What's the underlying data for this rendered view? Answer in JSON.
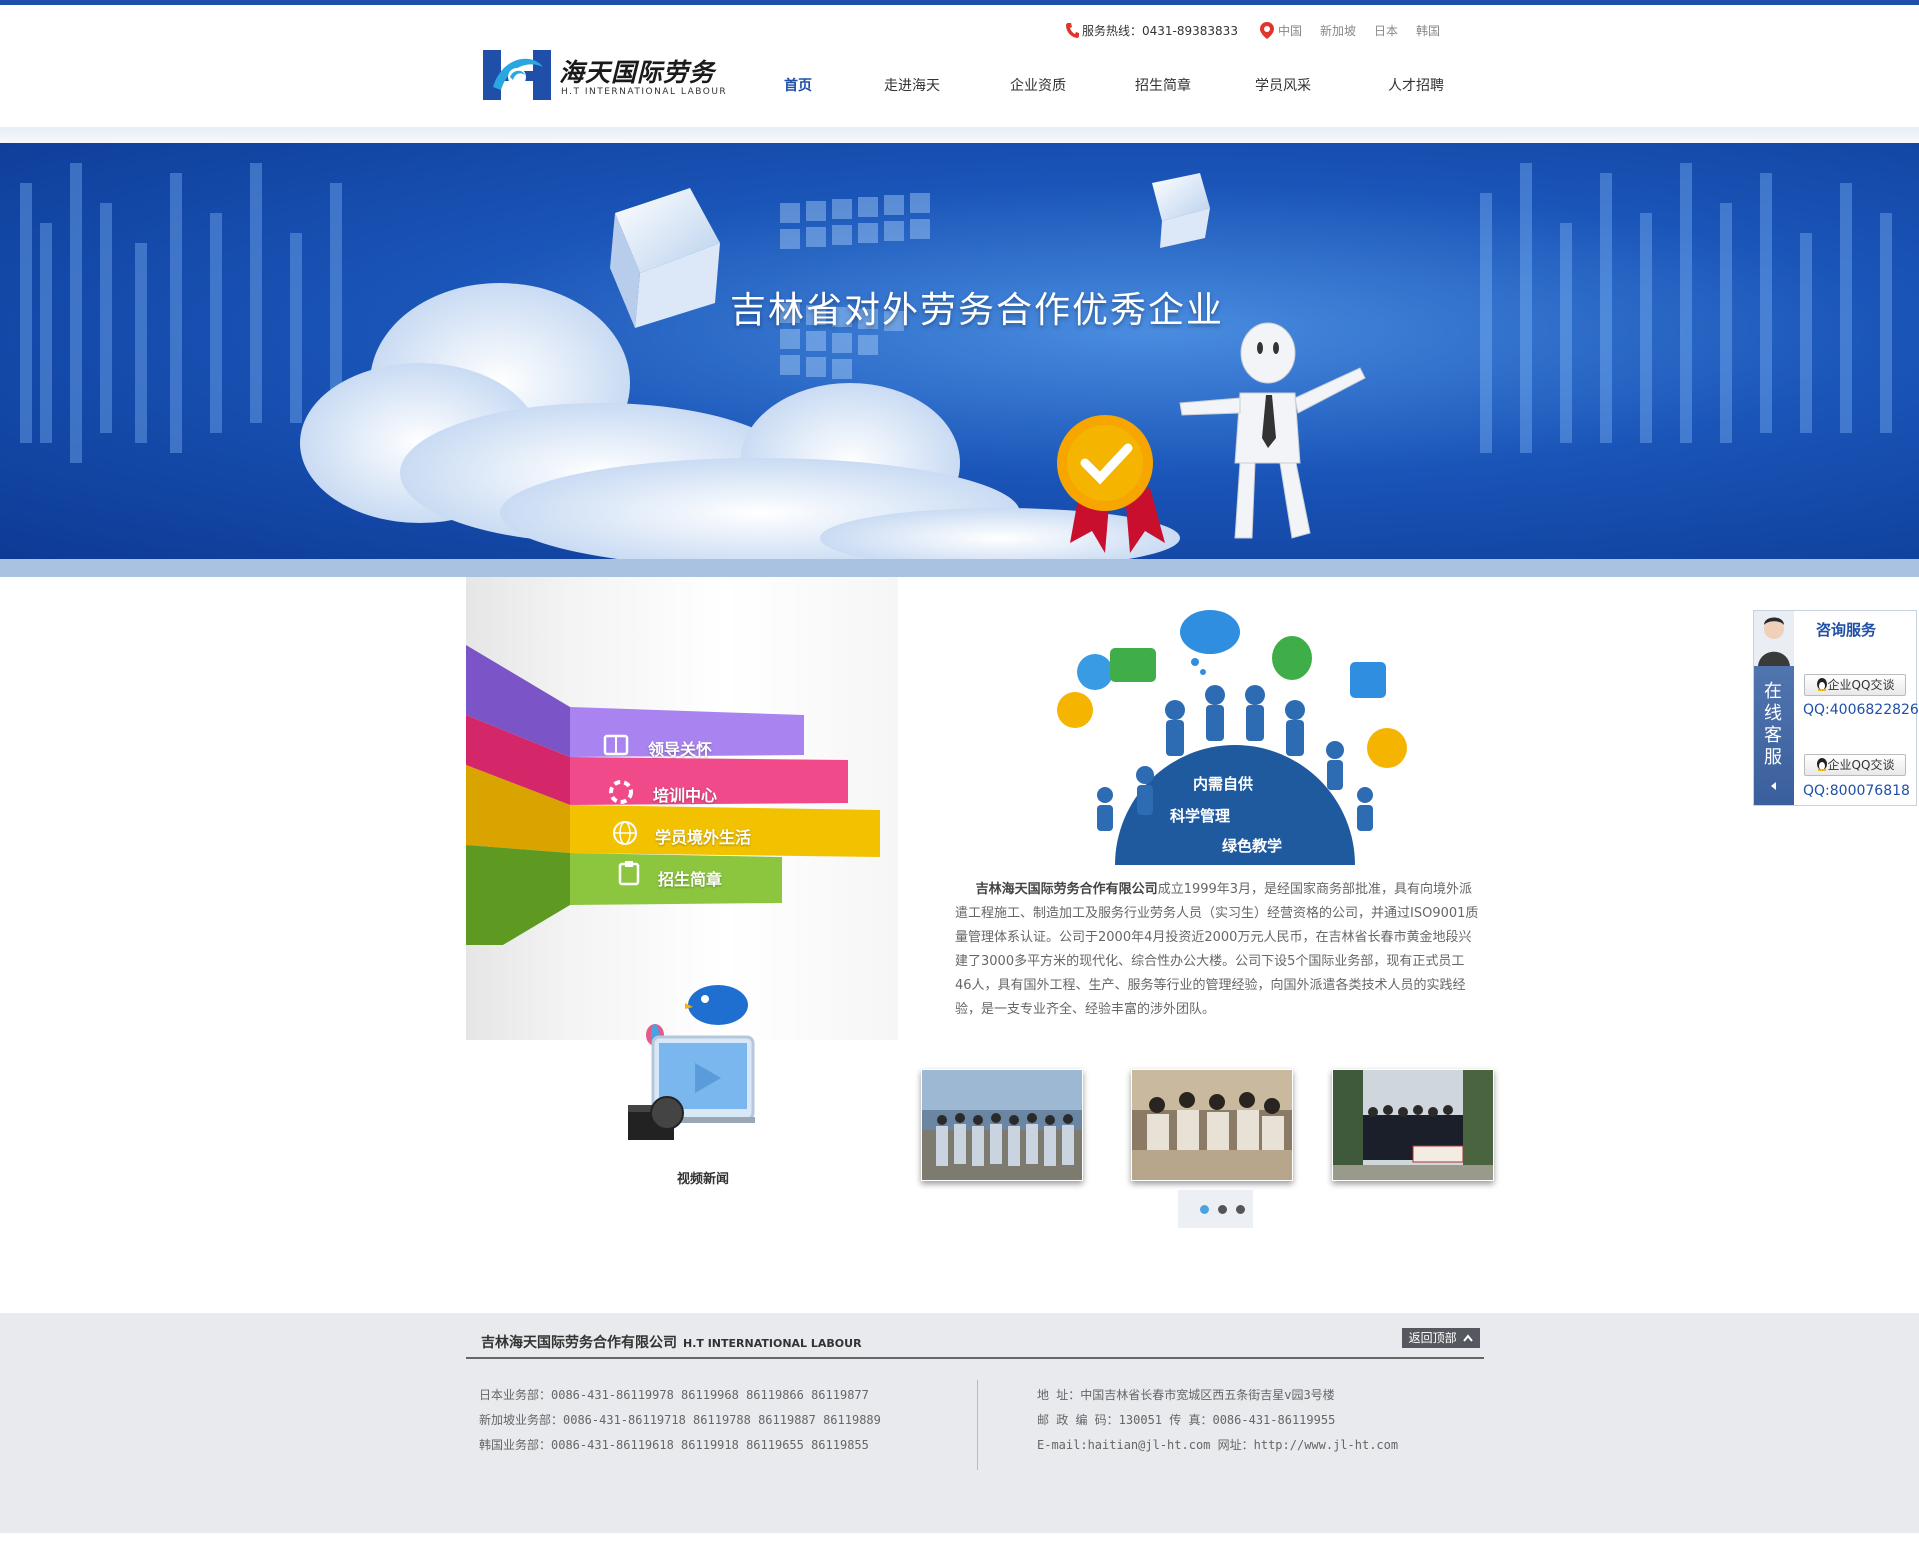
{
  "header": {
    "logo_cn": "海天国际劳务",
    "logo_en": "H.T INTERNATIONAL LABOUR",
    "hotline": "服务热线：0431-89383833",
    "regions": [
      "中国",
      "新加坡",
      "日本",
      "韩国"
    ],
    "nav": [
      "首页",
      "走进海天",
      "企业资质",
      "招生简章",
      "学员风采",
      "人才招聘"
    ]
  },
  "banner": {
    "title": "吉林省对外劳务合作优秀企业"
  },
  "feature": {
    "ribbons": [
      "领导关怀",
      "培训中心",
      "学员境外生活",
      "招生简章"
    ],
    "video_label": "视频新闻"
  },
  "graphic": {
    "lines": [
      "内需自供",
      "科学管理",
      "绿色教学"
    ]
  },
  "intro": {
    "company": "吉林海天国际劳务合作有限公司",
    "text": "成立1999年3月，是经国家商务部批准，具有向境外派遣工程施工、制造加工及服务行业劳务人员（实习生）经营资格的公司，并通过ISO9001质量管理体系认证。公司于2000年4月投资近2000万元人民币，在吉林省长春市黄金地段兴建了3000多平方米的现代化、综合性办公大楼。公司下设5个国际业务部，现有正式员工46人，具有国外工程、生产、服务等行业的管理经验，向国外派遣各类技术人员的实践经验，是一支专业齐全、经验丰富的涉外团队。"
  },
  "service": {
    "title": "咨询服务",
    "side_label": "在线客服",
    "buttons": [
      {
        "label": "企业QQ交谈",
        "qq": "QQ:4006822826"
      },
      {
        "label": "企业QQ交谈",
        "qq": "QQ:800076818"
      }
    ]
  },
  "footer": {
    "company": "吉林海天国际劳务合作有限公司",
    "company_en": "H.T INTERNATIONAL LABOUR",
    "back_top": "返回顶部",
    "left_lines": [
      "日本业务部：0086-431-86119978  86119968  86119866  86119877",
      "新加坡业务部：0086-431-86119718  86119788  86119887  86119889",
      "韩国业务部：0086-431-86119618  86119918  86119655  86119855"
    ],
    "right_lines": [
      "地      址：中国吉林省长春市宽城区西五条街吉星v园3号楼",
      "邮 政 编 码：130051        传  真：0086-431-86119955",
      "E-mail:haitian@jl-ht.com      网址：http://www.jl-ht.com"
    ]
  },
  "colors": {
    "brand_blue": "#1f4fa8",
    "ribbon_purple": "#9b6fe0",
    "ribbon_pink": "#f04a8a",
    "ribbon_yellow": "#f2c200",
    "ribbon_green": "#8cc63f"
  },
  "icons": [
    "phone-icon",
    "location-pin-icon",
    "qq-penguin-icon",
    "chevron-up-icon",
    "play-icon",
    "bird-icon"
  ]
}
